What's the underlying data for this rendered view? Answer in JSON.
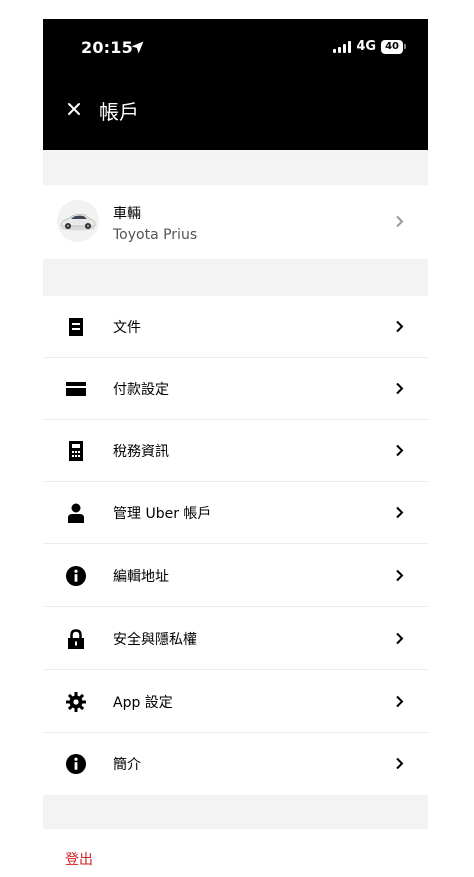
{
  "status_bar": {
    "time": "20:15",
    "network": "4G",
    "battery": "40"
  },
  "header": {
    "title": "帳戶"
  },
  "vehicle": {
    "title": "車輛",
    "model": "Toyota Prius"
  },
  "menu": [
    {
      "label": "文件",
      "icon": "document-icon"
    },
    {
      "label": "付款設定",
      "icon": "credit-card-icon"
    },
    {
      "label": "稅務資訊",
      "icon": "calculator-icon"
    },
    {
      "label": "管理 Uber 帳戶",
      "icon": "person-icon"
    },
    {
      "label": "編輯地址",
      "icon": "info-icon"
    },
    {
      "label": "安全與隱私權",
      "icon": "lock-icon"
    },
    {
      "label": "App 設定",
      "icon": "gear-icon"
    },
    {
      "label": "簡介",
      "icon": "info-icon"
    }
  ],
  "footer": {
    "logout_label": "登出"
  },
  "colors": {
    "header_bg": "#000000",
    "section_gap": "#f3f3f3",
    "logout": "#d11f1f"
  }
}
